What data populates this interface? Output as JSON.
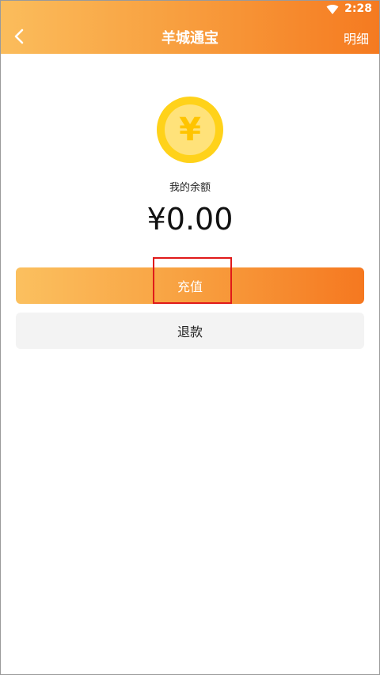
{
  "status_bar": {
    "time": "2:28",
    "wifi_icon": "wifi-icon"
  },
  "header": {
    "back_icon": "chevron-left-icon",
    "title": "羊城通宝",
    "detail_label": "明细"
  },
  "balance": {
    "coin_icon": "yen-coin-icon",
    "coin_symbol": "¥",
    "label": "我的余额",
    "amount": "¥0.00"
  },
  "actions": {
    "recharge_label": "充值",
    "refund_label": "退款"
  },
  "colors": {
    "accent_start": "#fbbd5c",
    "accent_end": "#f57a20",
    "coin": "#ffd21a",
    "highlight": "#e01a1a"
  }
}
